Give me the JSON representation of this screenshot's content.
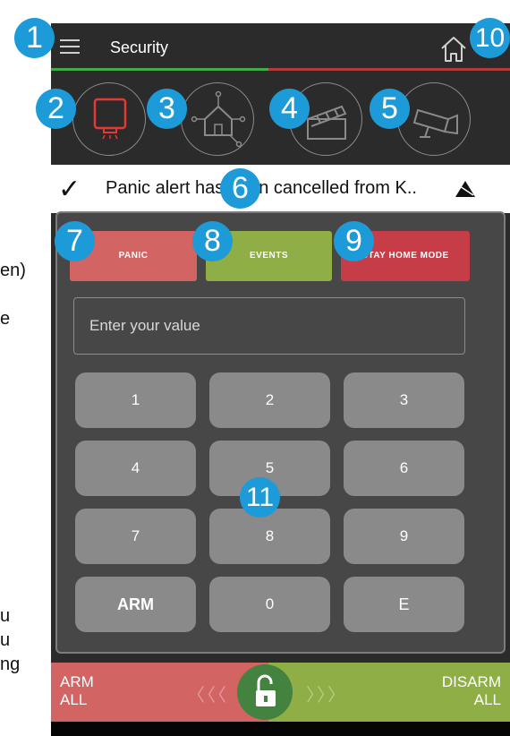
{
  "side_fragments": [
    "en)",
    "e",
    "u",
    "u",
    "ng"
  ],
  "header": {
    "title": "Security"
  },
  "icons": {
    "menu": "hamburger-menu-icon",
    "home": "home-icon",
    "panel": "alarm-panel-icon",
    "smart_home": "smart-home-icon",
    "scene": "clapperboard-icon",
    "camera": "security-camera-icon",
    "check": "check-icon",
    "alert": "warning-triangle-icon",
    "unlock": "unlock-icon"
  },
  "notification": {
    "check": "✓",
    "message": "Panic alert has been cancelled from K.."
  },
  "actions": {
    "panic": "PANIC",
    "events": "EVENTS",
    "home_mode": "STAY HOME MODE"
  },
  "keypad": {
    "placeholder": "Enter your value",
    "keys": [
      "1",
      "2",
      "3",
      "4",
      "5",
      "6",
      "7",
      "8",
      "9",
      "ARM",
      "0",
      "E"
    ]
  },
  "slider": {
    "left_line1": "ARM",
    "left_line2": "ALL",
    "right_line1": "DISARM",
    "right_line2": "ALL",
    "chevrons_left": "〈〈〈",
    "chevrons_right": "〉〉〉"
  },
  "markers": [
    "1",
    "2",
    "3",
    "4",
    "5",
    "6",
    "7",
    "8",
    "9",
    "10",
    "11"
  ],
  "colors": {
    "accent_blue": "#1d9ad8",
    "panic_red": "#d26464",
    "events_green": "#8fae45",
    "home_mode_red": "#c63d48",
    "active_icon_red": "#e53935"
  }
}
